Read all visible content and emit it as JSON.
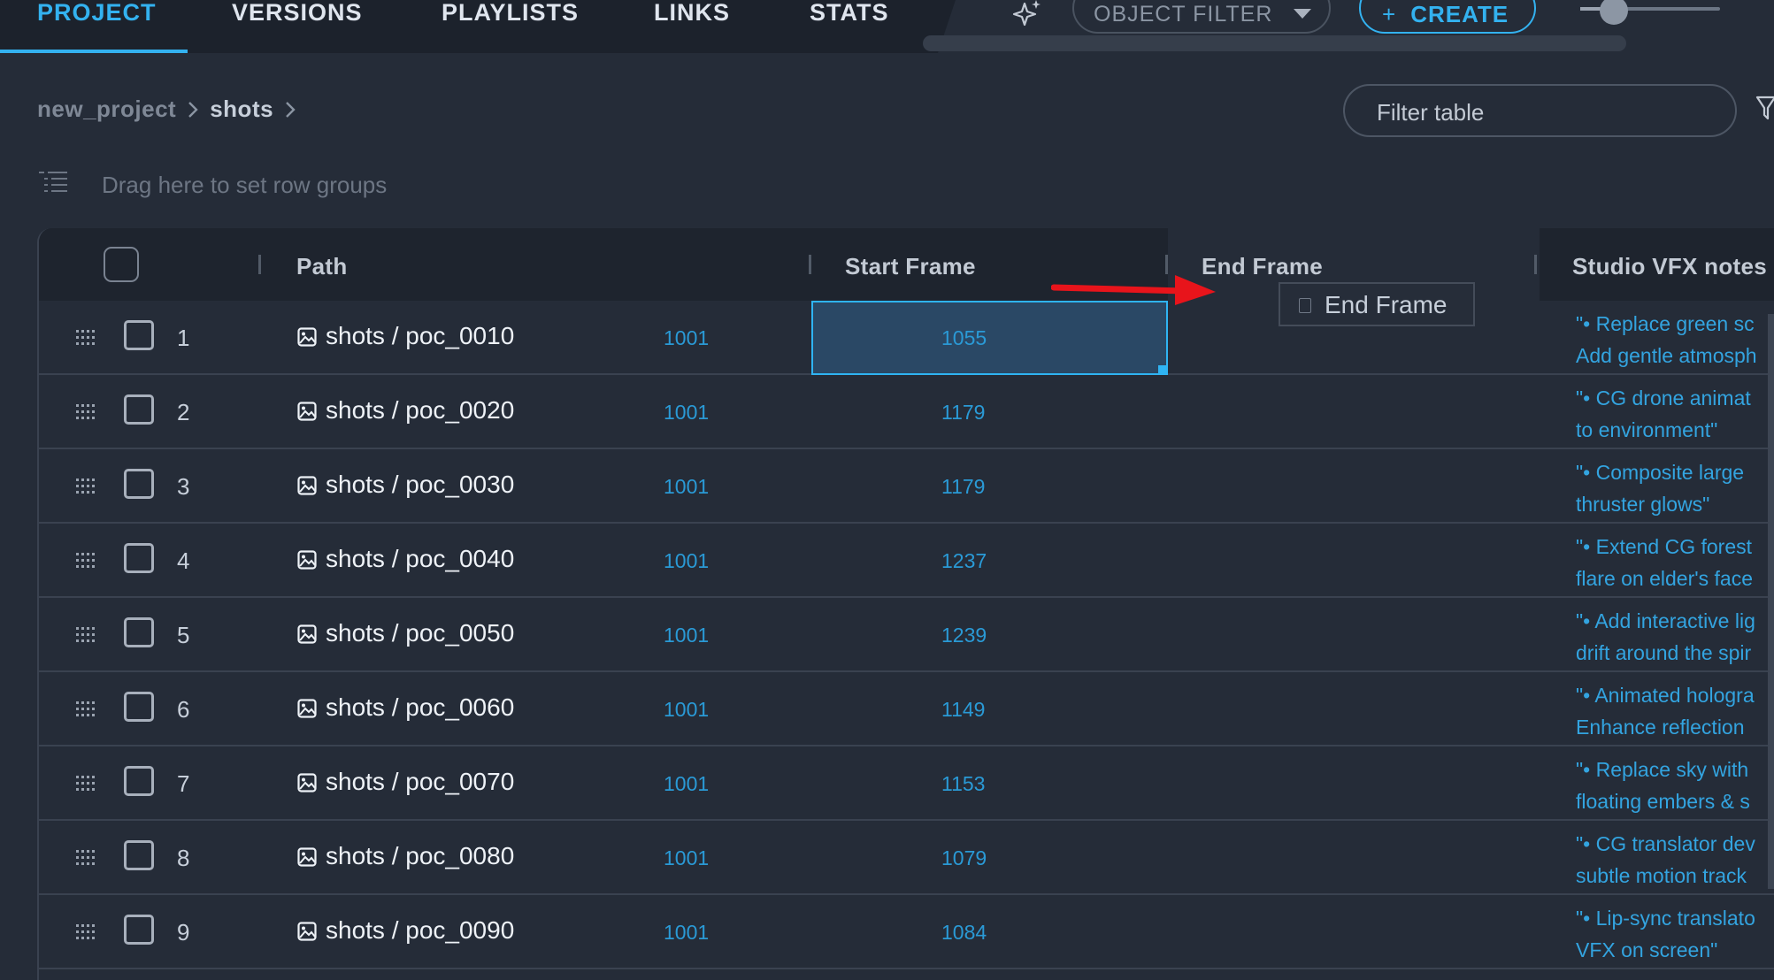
{
  "nav": {
    "tabs": [
      {
        "label": "PROJECT",
        "active": true
      },
      {
        "label": "VERSIONS",
        "active": false
      },
      {
        "label": "PLAYLISTS",
        "active": false
      },
      {
        "label": "LINKS",
        "active": false
      },
      {
        "label": "STATS",
        "active": false
      }
    ],
    "object_filter_label": "OBJECT FILTER",
    "create_label": "CREATE",
    "accent_color": "#33b2f0"
  },
  "breadcrumb": {
    "root": "new_project",
    "current": "shots"
  },
  "filter": {
    "placeholder": "Filter table"
  },
  "row_groups": {
    "hint": "Drag here to set row groups"
  },
  "table": {
    "columns": [
      "Path",
      "Start Frame",
      "End Frame",
      "Studio VFX notes"
    ],
    "rows": [
      {
        "num": "1",
        "path": "shots / poc_0010",
        "start": "1001",
        "end": "1055",
        "notes1": "\"• Replace green sc",
        "notes2": "Add gentle atmosph"
      },
      {
        "num": "2",
        "path": "shots / poc_0020",
        "start": "1001",
        "end": "1179",
        "notes1": "\"• CG drone animat",
        "notes2": "to environment\""
      },
      {
        "num": "3",
        "path": "shots / poc_0030",
        "start": "1001",
        "end": "1179",
        "notes1": "\"• Composite large",
        "notes2": "thruster glows\""
      },
      {
        "num": "4",
        "path": "shots / poc_0040",
        "start": "1001",
        "end": "1237",
        "notes1": "\"• Extend CG forest",
        "notes2": "flare on elder's face"
      },
      {
        "num": "5",
        "path": "shots / poc_0050",
        "start": "1001",
        "end": "1239",
        "notes1": "\"• Add interactive lig",
        "notes2": "drift around the spir"
      },
      {
        "num": "6",
        "path": "shots / poc_0060",
        "start": "1001",
        "end": "1149",
        "notes1": "\"• Animated hologra",
        "notes2": "Enhance reflection"
      },
      {
        "num": "7",
        "path": "shots / poc_0070",
        "start": "1001",
        "end": "1153",
        "notes1": "\"• Replace sky with",
        "notes2": "floating embers & s"
      },
      {
        "num": "8",
        "path": "shots / poc_0080",
        "start": "1001",
        "end": "1079",
        "notes1": "\"• CG translator dev",
        "notes2": "subtle motion track"
      },
      {
        "num": "9",
        "path": "shots / poc_0090",
        "start": "1001",
        "end": "1084",
        "notes1": "\"• Lip-sync translato",
        "notes2": "VFX on screen\""
      }
    ],
    "selected_cell": {
      "row": 1,
      "column": "Start Frame"
    }
  },
  "drag_ghost": {
    "label": "End Frame"
  },
  "icons": {
    "sparkle": "sparkle-icon",
    "caret": "caret-down-icon",
    "plus": "plus-icon",
    "chevron": "chevron-right-icon",
    "funnel": "filter-funnel-icon",
    "row_groups": "row-groups-icon",
    "drag": "drag-handle-icon",
    "image": "image-icon",
    "arrow": "red-arrow-annotation"
  }
}
